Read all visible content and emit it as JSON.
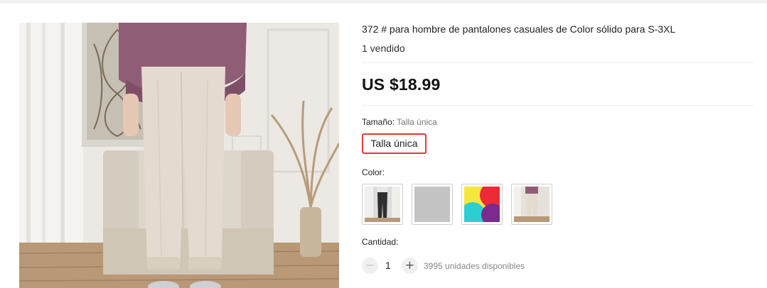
{
  "product": {
    "title": "372 # para hombre de pantalones casuales de Color sólido para S-3XL",
    "sold": "1 vendido",
    "price": "US $18.99"
  },
  "size": {
    "label": "Tamaño:",
    "selected": "Talla única",
    "option": "Talla única"
  },
  "color": {
    "label": "Color:",
    "swatches": [
      "photo-black-pants",
      "solid-gray",
      "multicolor-pattern",
      "photo-beige-pants"
    ]
  },
  "quantity": {
    "label": "Cantidad:",
    "minus_symbol": "−",
    "plus_symbol": "+",
    "value": "1",
    "available": "3995 unidades disponibles"
  },
  "colors": {
    "accent": "#e03a3a",
    "divider": "#eeeeee",
    "swatch_gray": "#c4c4c4",
    "pattern_yellow": "#f4e83c",
    "pattern_red": "#ee2a36",
    "pattern_cyan": "#2ccfd0",
    "pattern_purple": "#7b2a8f"
  }
}
